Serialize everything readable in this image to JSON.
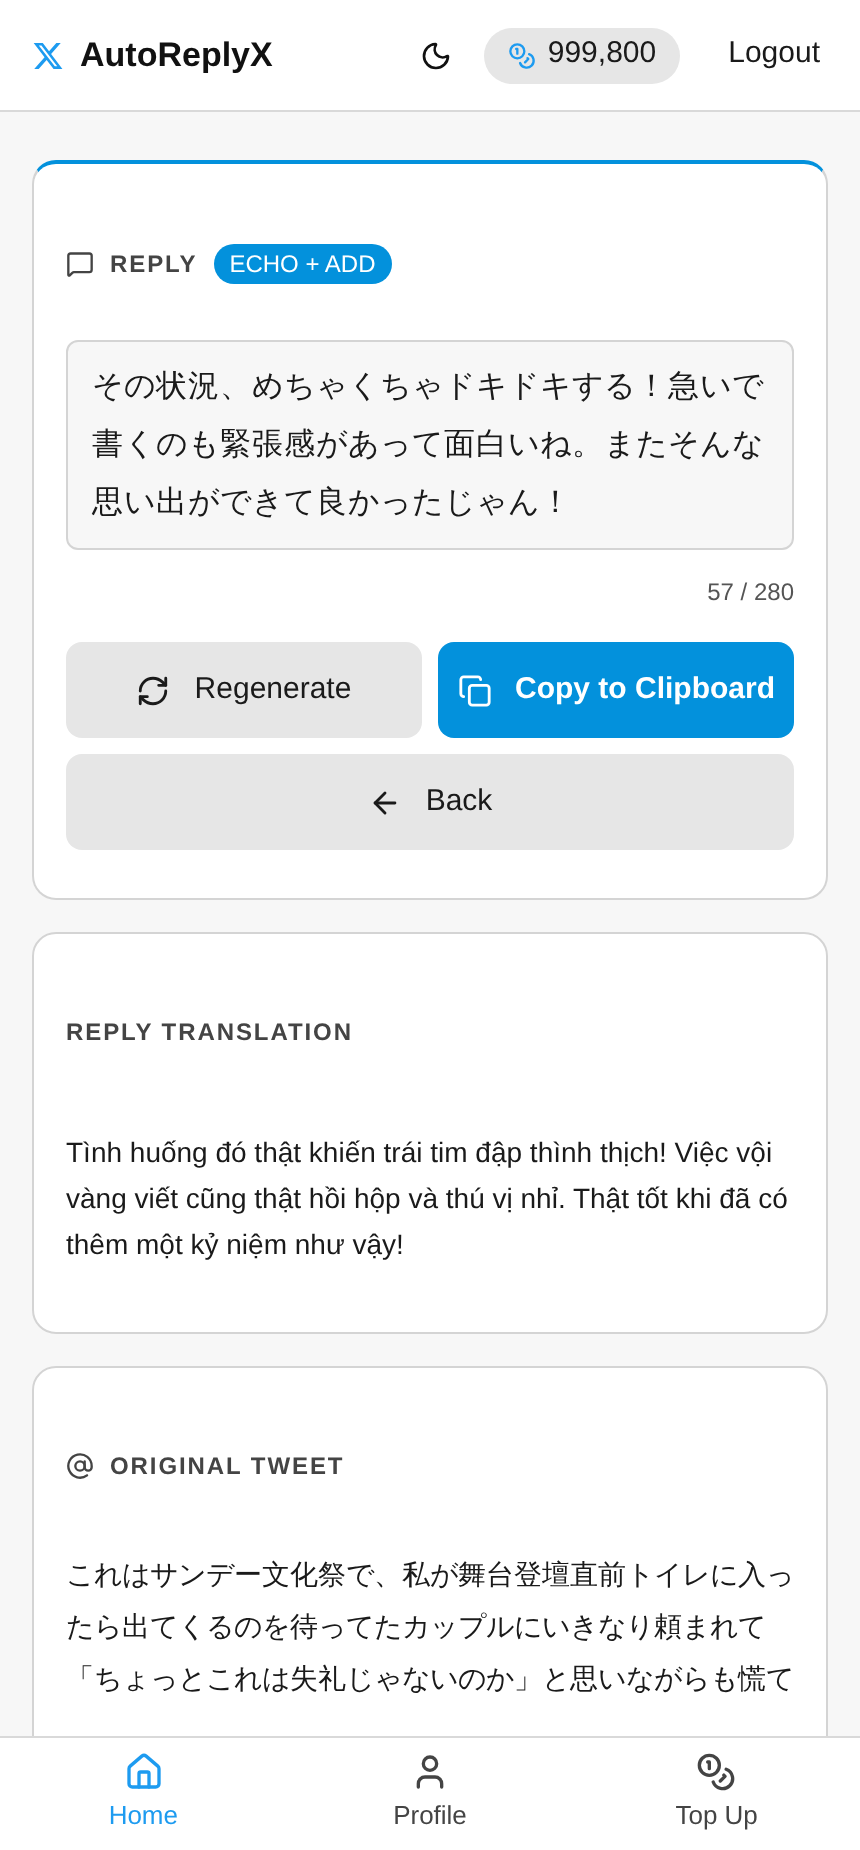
{
  "header": {
    "app_name": "AutoReplyX",
    "balance": "999,800",
    "logout": "Logout"
  },
  "reply_card": {
    "label": "REPLY",
    "badge": "ECHO + ADD",
    "reply_text": "その状況、めちゃくちゃドキドキする！急いで書くのも緊張感があって面白いね。またそんな思い出ができて良かったじゃん！",
    "counter": "57 / 280",
    "buttons": [
      {
        "kind": "regenerate",
        "label": "Regenerate"
      },
      {
        "kind": "copy",
        "label": "Copy to Clipboard"
      },
      {
        "kind": "back",
        "label": "Back"
      }
    ]
  },
  "translation_card": {
    "label": "REPLY TRANSLATION",
    "text": "Tình huống đó thật khiến trái tim đập thình thịch! Việc vội vàng viết cũng thật hồi hộp và thú vị nhỉ. Thật tốt khi đã có thêm một kỷ niệm như vậy!"
  },
  "tweet_card": {
    "label": "ORIGINAL TWEET",
    "text": "これはサンデー文化祭で、私が舞台登壇直前トイレに入ったら出てくるのを待ってたカップルにいきなり頼まれて「ちょっとこれは失礼じゃないのか」と思いながらも慌て"
  },
  "bottom_nav": [
    {
      "kind": "home",
      "label": "Home",
      "selected": true
    },
    {
      "kind": "profile",
      "label": "Profile",
      "selected": false
    },
    {
      "kind": "topup",
      "label": "Top Up",
      "selected": false
    }
  ]
}
